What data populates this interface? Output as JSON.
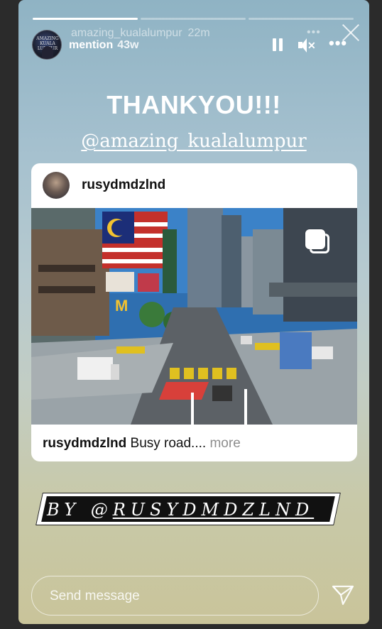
{
  "story": {
    "progress": [
      {
        "fill_percent": 100
      },
      {
        "fill_percent": 0
      },
      {
        "fill_percent": 0
      }
    ],
    "prev_account": {
      "username": "amazing_kualalumpur",
      "time": "22m",
      "avatar_text": "AMAZING KUALA LUMPUR"
    },
    "header": {
      "username": "mention",
      "time": "43w"
    },
    "title": "THANKYOU!!!",
    "mention": "@amazing_kualalumpur",
    "post": {
      "username": "rusydmdzlnd",
      "caption_user": "rusydmdzlnd",
      "caption_text": "Busy road....",
      "more_label": "more"
    },
    "by_prefix": "BY @",
    "by_handle": "RUSYDMDZLND",
    "send_placeholder": "Send message"
  },
  "icons": [
    "pause-icon",
    "mute-icon",
    "more-icon",
    "close-icon",
    "carousel-icon",
    "send-icon"
  ],
  "colors": {
    "background": "#2b2b2b",
    "card": "#ffffff",
    "label_bg": "#111111"
  }
}
